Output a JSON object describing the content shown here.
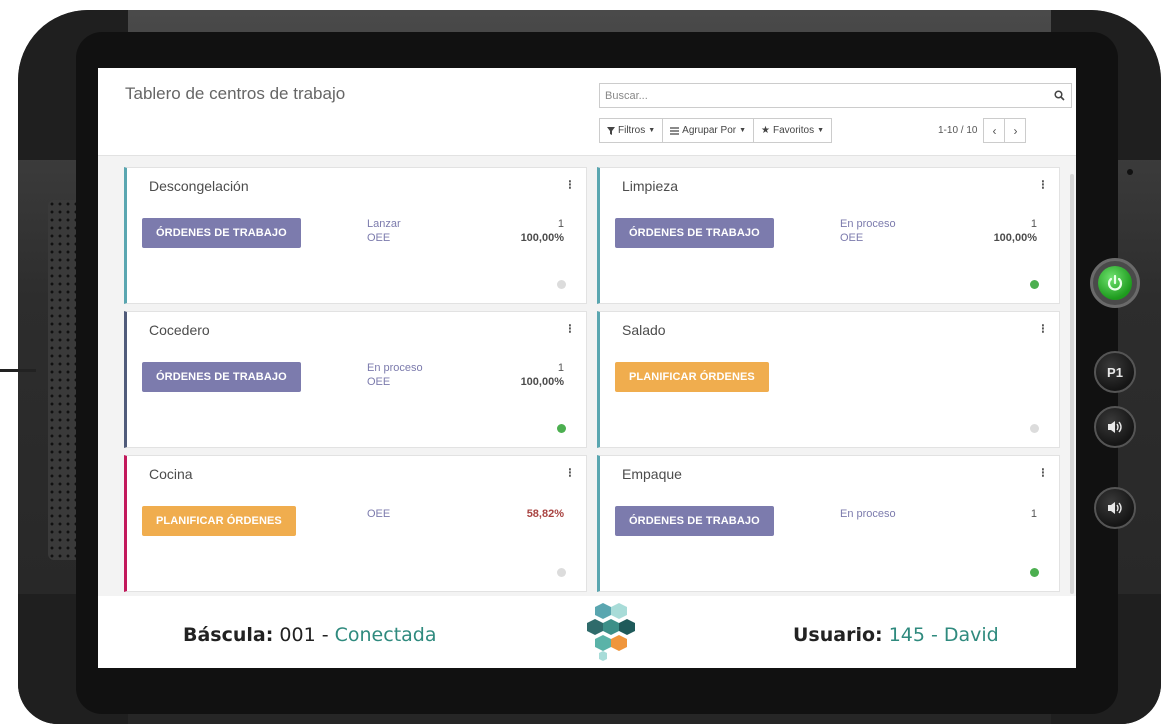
{
  "header": {
    "title": "Tablero de centros de trabajo",
    "search_placeholder": "Buscar...",
    "filters_label": "Filtros",
    "group_by_label": "Agrupar Por",
    "favorites_label": "Favoritos",
    "pager": "1-10 / 10"
  },
  "cards": [
    {
      "name": "Descongelación",
      "button": "Órdenes de trabajo",
      "button_style": "primary",
      "border_color": "#5aa6b0",
      "stats": [
        {
          "label": "Lanzar",
          "value": "1"
        },
        {
          "label": "OEE",
          "value": "100,00%"
        }
      ],
      "status": "grey"
    },
    {
      "name": "Limpieza",
      "button": "Órdenes de trabajo",
      "button_style": "primary",
      "border_color": "#5aa6b0",
      "stats": [
        {
          "label": "En proceso",
          "value": "1"
        },
        {
          "label": "OEE",
          "value": "100,00%"
        }
      ],
      "status": "green"
    },
    {
      "name": "Cocedero",
      "button": "Órdenes de trabajo",
      "button_style": "primary",
      "border_color": "#505b7a",
      "stats": [
        {
          "label": "En proceso",
          "value": "1"
        },
        {
          "label": "OEE",
          "value": "100,00%"
        }
      ],
      "status": "green"
    },
    {
      "name": "Salado",
      "button": "Planificar órdenes",
      "button_style": "warning",
      "border_color": "#5aa6b0",
      "stats": [],
      "status": "grey"
    },
    {
      "name": "Cocina",
      "button": "Planificar órdenes",
      "button_style": "warning",
      "border_color": "#c2185b",
      "stats": [
        {
          "label": "OEE",
          "value": "58,82%"
        }
      ],
      "status": "grey"
    },
    {
      "name": "Empaque",
      "button": "Órdenes de trabajo",
      "button_style": "primary",
      "border_color": "#5aa6b0",
      "stats": [
        {
          "label": "En proceso",
          "value": "1"
        }
      ],
      "status": "green"
    }
  ],
  "footer": {
    "scale_label": "Báscula",
    "scale_value": "001 -",
    "scale_status": "Conectada",
    "user_label": "Usuario",
    "user_value": "145 - David"
  },
  "device": {
    "p1_label": "P1"
  },
  "colors": {
    "primary": "#7c7bad",
    "warning": "#f0ad4e",
    "ok": "#4caf50",
    "danger": "#a94442",
    "teal": "#2f8a7e"
  },
  "icons": [
    "search-icon",
    "filter-icon",
    "list-icon",
    "star-icon",
    "chevron-left-icon",
    "chevron-right-icon",
    "kebab-menu-icon",
    "power-icon",
    "speaker-icon"
  ]
}
